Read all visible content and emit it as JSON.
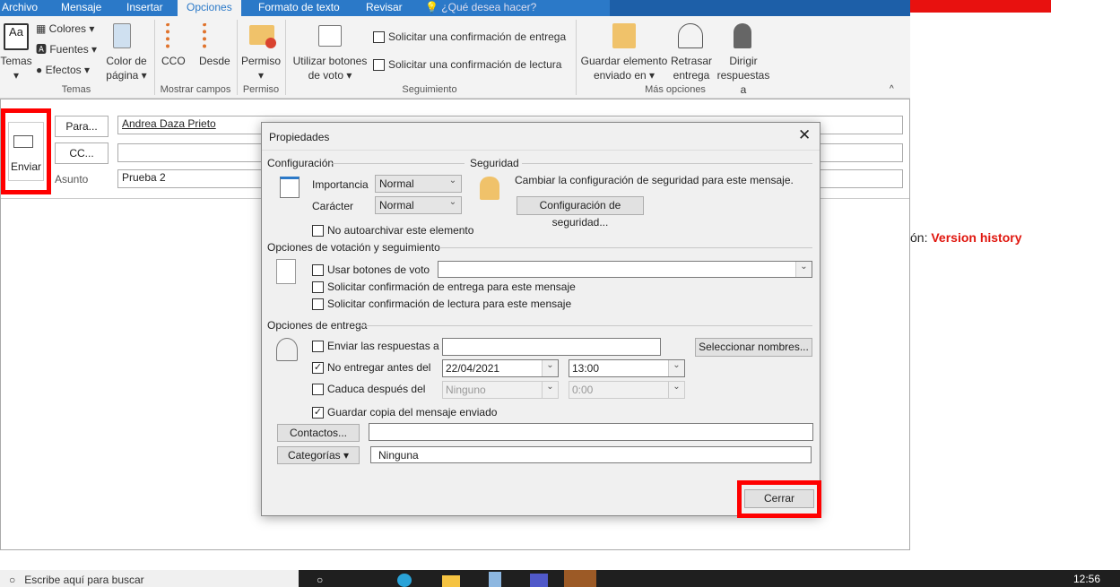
{
  "tabs": [
    "Archivo",
    "Mensaje",
    "Insertar",
    "Opciones",
    "Formato de texto",
    "Revisar"
  ],
  "tell_me": "¿Qué desea hacer?",
  "ribbon": {
    "temas": "Temas",
    "colores": "Colores",
    "fuentes": "Fuentes",
    "efectos": "Efectos",
    "color_pagina_1": "Color de",
    "color_pagina_2": "página",
    "cco": "CCO",
    "desde": "Desde",
    "permiso": "Permiso",
    "votos_1": "Utilizar botones",
    "votos_2": "de voto",
    "conf_entrega": "Solicitar una confirmación de entrega",
    "conf_lectura": "Solicitar una confirmación de lectura",
    "guardar_1": "Guardar elemento",
    "guardar_2": "enviado en",
    "retrasar_1": "Retrasar",
    "retrasar_2": "entrega",
    "dirigir_1": "Dirigir",
    "dirigir_2": "respuestas a",
    "groups": [
      "Temas",
      "Mostrar campos",
      "Permiso",
      "Seguimiento",
      "Más opciones"
    ]
  },
  "compose": {
    "send": "Enviar",
    "to_btn": "Para...",
    "cc_btn": "CC...",
    "subject_label": "Asunto",
    "to_value": "Andrea Daza Prieto",
    "subject_value": "Prueba 2"
  },
  "side": {
    "prefix": "ón: ",
    "link": "Version history"
  },
  "dialog": {
    "title": "Propiedades",
    "config": "Configuración",
    "importance_label": "Importancia",
    "importance": "Normal",
    "sensitivity_label": "Carácter",
    "sensitivity": "Normal",
    "no_archive": "No autoarchivar este elemento",
    "security": "Seguridad",
    "security_text": "Cambiar la configuración de seguridad para este mensaje.",
    "security_btn": "Configuración de seguridad...",
    "voting": "Opciones de votación y seguimiento",
    "use_vote": "Usar botones de voto",
    "vote_value": "",
    "req_delivery": "Solicitar confirmación de entrega para este mensaje",
    "req_read": "Solicitar confirmación de lectura para este mensaje",
    "delivery": "Opciones de entrega",
    "reply_to": "Enviar las respuestas a",
    "reply_value": "",
    "select_names": "Seleccionar nombres...",
    "not_before": "No entregar antes del",
    "not_before_date": "22/04/2021",
    "not_before_time": "13:00",
    "expires": "Caduca después del",
    "expires_date": "Ninguno",
    "expires_time": "0:00",
    "save_copy": "Guardar copia del mensaje enviado",
    "contacts_btn": "Contactos...",
    "contacts_value": "",
    "categories_btn": "Categorías",
    "categories_value": "Ninguna",
    "close": "Cerrar"
  },
  "taskbar": {
    "search": "Escribe aquí para buscar",
    "time": "12:56"
  },
  "colors": {
    "accent": "#2b79c8",
    "highlight": "#ff0000"
  }
}
